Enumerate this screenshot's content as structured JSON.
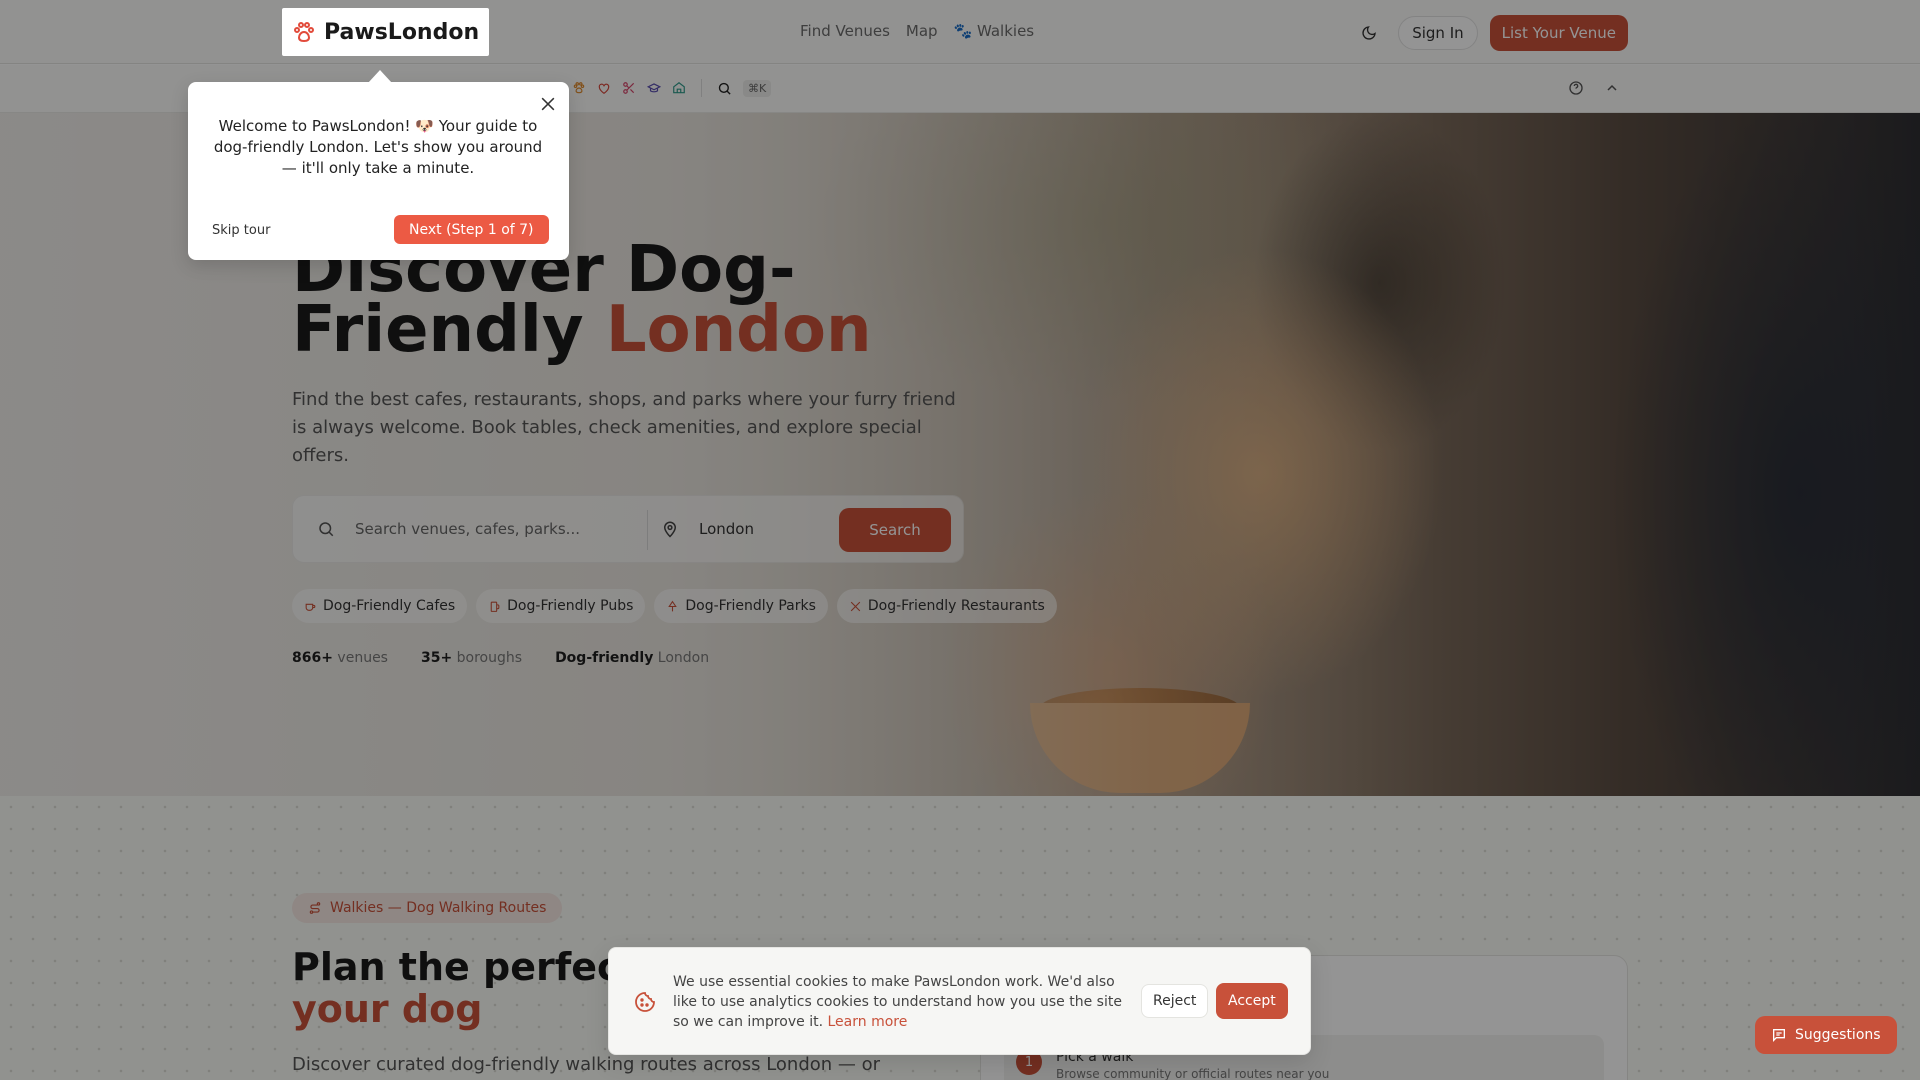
{
  "header": {
    "logo_text": "PawsLondon",
    "nav": [
      "Find Venues",
      "Map",
      "🐾 Walkies"
    ],
    "sign_in": "Sign In",
    "list_venue": "List Your Venue"
  },
  "toolbar": {
    "icons": [
      "dog-paw-icon",
      "heart-pulse-icon",
      "scissors-icon",
      "graduation-cap-icon",
      "home-icon"
    ],
    "search_shortcut": "⌘K"
  },
  "tour": {
    "text": "Welcome to PawsLondon! 🐶 Your guide to dog-friendly London. Let's show you around — it'll only take a minute.",
    "skip": "Skip tour",
    "next": "Next (Step 1 of 7)"
  },
  "hero": {
    "title_part1": "Discover Dog-Friendly ",
    "title_accent": "London",
    "subtitle": "Find the best cafes, restaurants, shops, and parks where your furry friend is always welcome. Book tables, check amenities, and explore special offers.",
    "search_placeholder": "Search venues, cafes, parks...",
    "location_value": "London",
    "search_button": "Search",
    "chips": [
      "Dog-Friendly Cafes",
      "Dog-Friendly Pubs",
      "Dog-Friendly Parks",
      "Dog-Friendly Restaurants"
    ],
    "stats": [
      {
        "value": "866+",
        "label": "venues"
      },
      {
        "value": "35+",
        "label": "boroughs"
      },
      {
        "value": "Dog-friendly",
        "label": "London"
      }
    ]
  },
  "walkies": {
    "badge": "Walkies — Dog Walking Routes",
    "title_part1": "Plan the perfect",
    "title_accent": "your dog",
    "description": "Discover curated dog-friendly walking routes across London — or",
    "step_number": "1",
    "step_title": "Pick a walk",
    "step_sub": "Browse community or official routes near you"
  },
  "cookie": {
    "text": "We use essential cookies to make PawsLondon work. We'd also like to use analytics cookies to understand how you use the site so we can improve it.",
    "link": "Learn more",
    "reject": "Reject",
    "accept": "Accept"
  },
  "suggestions": "Suggestions",
  "colors": {
    "accent": "#c8513a",
    "tour_button": "#ec5a44"
  }
}
